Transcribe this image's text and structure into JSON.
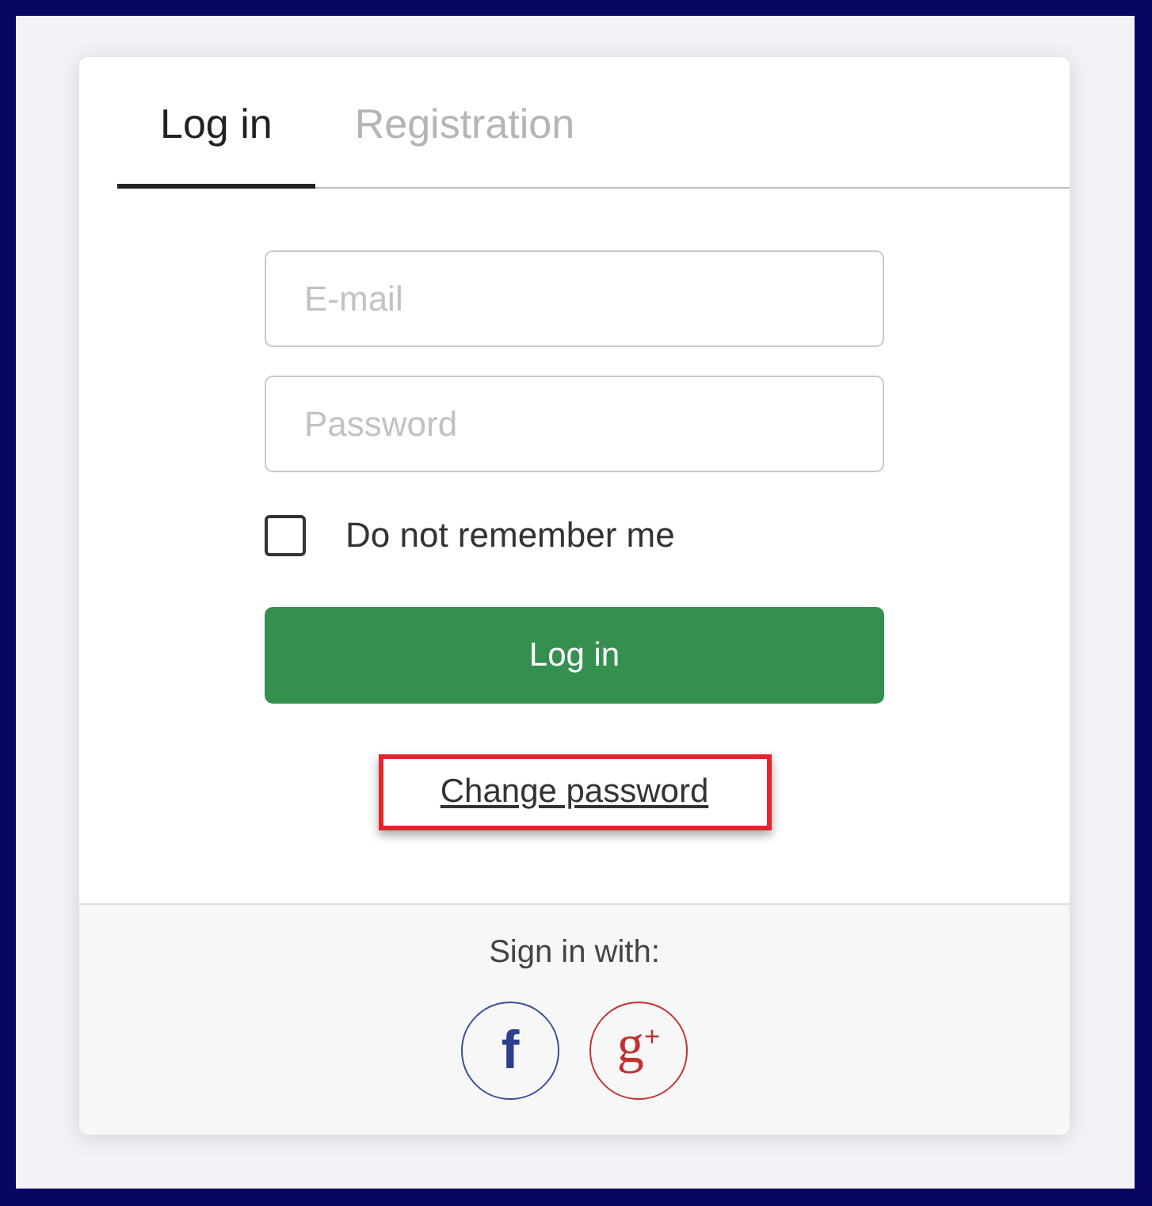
{
  "tabs": [
    {
      "label": "Log in",
      "selected": true
    },
    {
      "label": "Registration",
      "selected": false
    }
  ],
  "fields": [
    {
      "placeholder": "E-mail"
    },
    {
      "placeholder": "Password"
    }
  ],
  "remember_checkbox": {
    "label": "Do not remember me",
    "checked": false
  },
  "submit_button": {
    "label": "Log in"
  },
  "change_password_link": {
    "label": "Change password",
    "highlighted": true
  },
  "social": {
    "title": "Sign in with:",
    "buttons": [
      {
        "kind": "facebook",
        "glyph": "f"
      },
      {
        "kind": "google_plus",
        "glyph": "g$^{+}$"
      }
    ]
  }
}
